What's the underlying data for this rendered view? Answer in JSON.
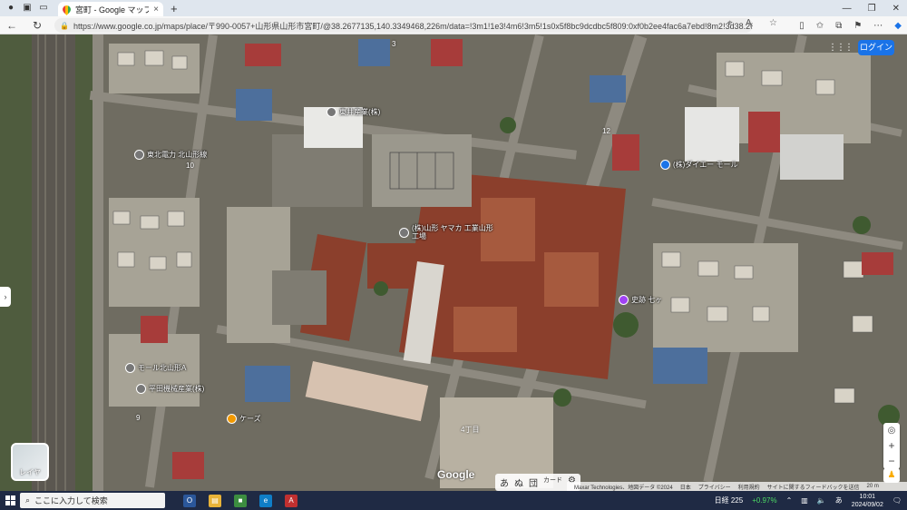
{
  "browser": {
    "tab_title": "宮町 - Google マップ",
    "url": "https://www.google.co.jp/maps/place/〒990-0057+山形県山形市宮町/@38.2677135,140.3349468,226m/data=!3m1!1e3!4m6!3m5!1s0x5f8bc9dcdbc5f809:0xf0b2ee4fac6a7ebd!8m2!3d38.2668971!4d140.3362682!16s%2F",
    "tab_close": "×",
    "new_tab": "+",
    "icons": [
      "back-icon",
      "refresh-icon",
      "lock-icon",
      "star-icon",
      "menu-icon"
    ]
  },
  "map": {
    "signin_label": "ログイン",
    "layers_label": "レイヤ",
    "google_logo": "Google",
    "pois": [
      {
        "name": "東北電力 北山形線",
        "color": "gray"
      },
      {
        "name": "東井産業(株)",
        "color": "gray"
      },
      {
        "name": "三十日運輸(株)",
        "color": "gray"
      },
      {
        "name": "(株)山形 ヤマカ 工業山形工場",
        "color": "gray"
      },
      {
        "name": "(株)ダイエー モール",
        "color": "blue"
      },
      {
        "name": "史跡 七ヶ",
        "color": "purple"
      },
      {
        "name": "モール北山形A",
        "color": "gray"
      },
      {
        "name": "平田機械産業(株)",
        "color": "gray"
      },
      {
        "name": "ケーズ",
        "color": "orange"
      }
    ],
    "street_labels": [
      "3",
      "12",
      "10",
      "9",
      "4丁目"
    ],
    "bottom_tools": [
      "あ",
      "ぬ",
      "団",
      "カード",
      "⚙"
    ],
    "attribution": [
      "Maxar Technologies、地図データ ©2024",
      "日本",
      "プライバシー",
      "利用規約",
      "サイトに関するフィードバックを送信",
      "20 m"
    ]
  },
  "taskbar": {
    "search_placeholder": "ここに入力して検索",
    "weather": "日経 225",
    "weather_change": "+0.97%",
    "time": "10:01",
    "date": "2024/09/02"
  }
}
